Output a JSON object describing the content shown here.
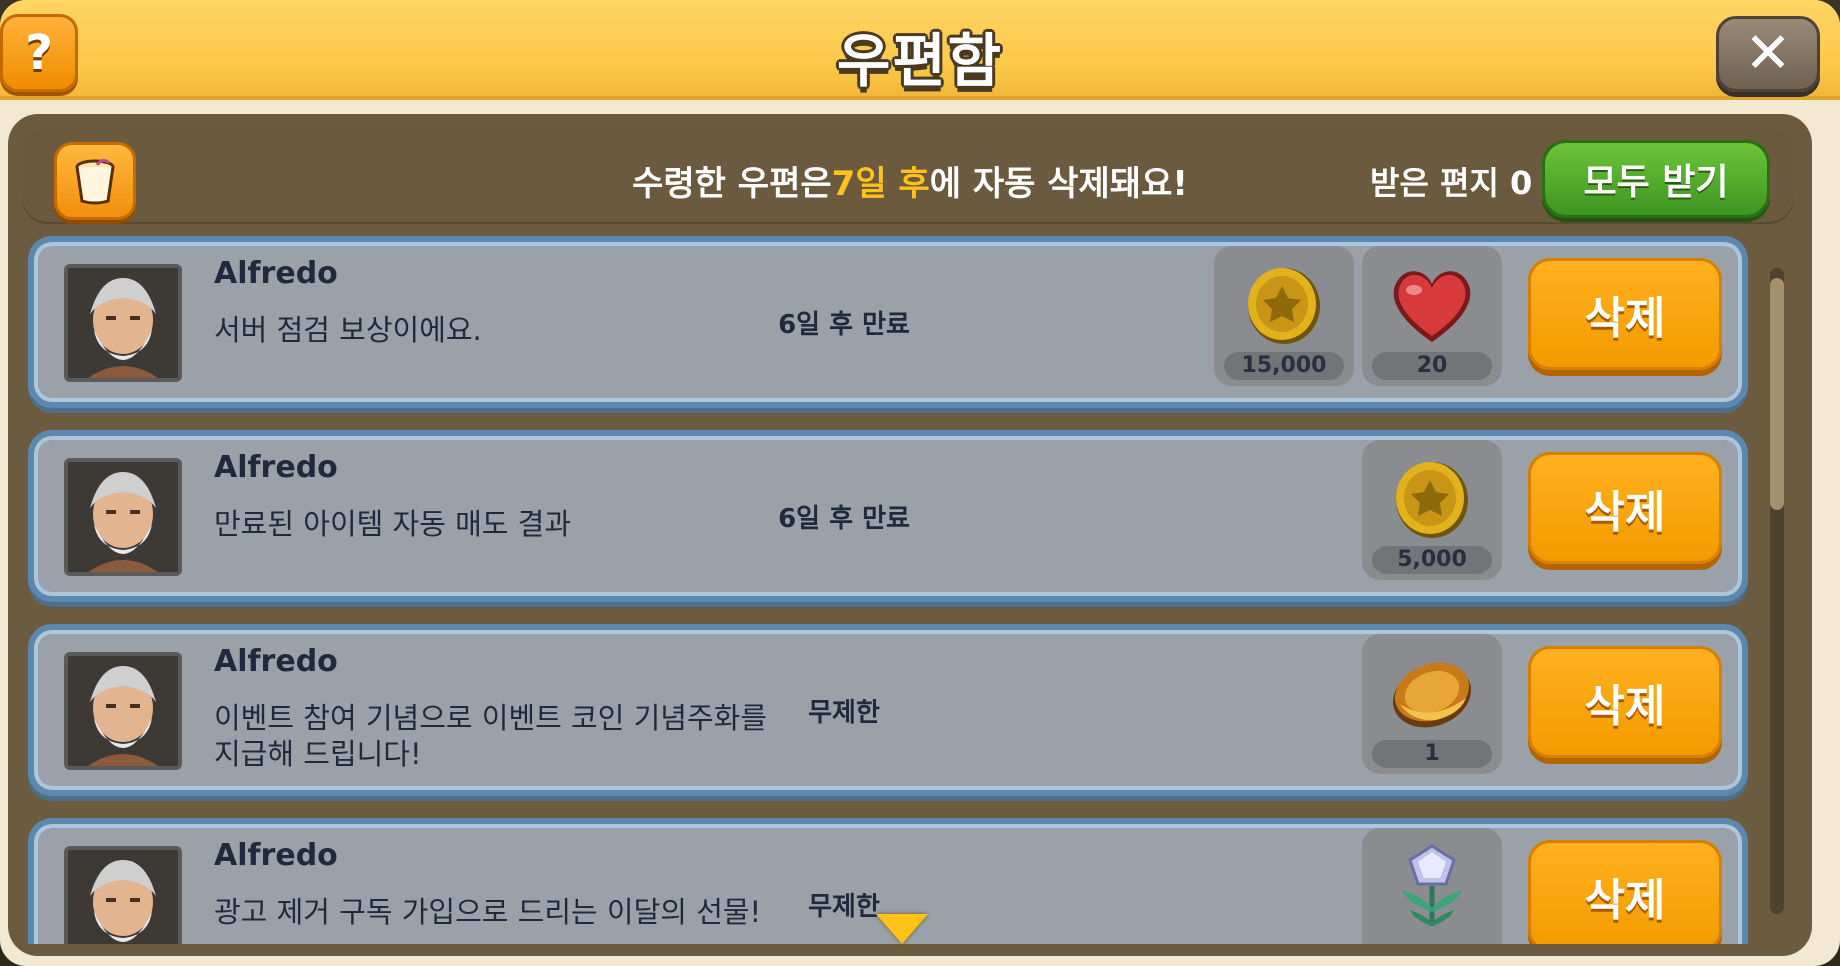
{
  "window": {
    "title": "우편함"
  },
  "header": {
    "help_label": "?",
    "close_label": "✕",
    "notice_before": "수령한 우편은",
    "notice_highlight": "7일 후",
    "notice_after": "에 자동 삭제돼요!",
    "received_label": "받은 편지 0",
    "receive_all_label": "모두 받기"
  },
  "mails": [
    {
      "sender": "Alfredo",
      "message": "서버 점검 보상이에요.",
      "expiry": "6일 후 만료",
      "rewards": [
        {
          "icon": "gold-coin-icon",
          "qty": "15,000"
        },
        {
          "icon": "heart-icon",
          "qty": "20"
        }
      ],
      "delete_label": "삭제"
    },
    {
      "sender": "Alfredo",
      "message": "만료된 아이템 자동 매도 결과",
      "expiry": "6일 후 만료",
      "rewards": [
        {
          "icon": "gold-coin-icon",
          "qty": "5,000"
        }
      ],
      "delete_label": "삭제"
    },
    {
      "sender": "Alfredo",
      "message": "이벤트 참여 기념으로 이벤트 코인 기념주화를 지급해 드립니다!",
      "expiry": "무제한",
      "rewards": [
        {
          "icon": "commemorative-coin-icon",
          "qty": "1"
        }
      ],
      "delete_label": "삭제"
    },
    {
      "sender": "Alfredo",
      "message": "광고 제거 구독 가입으로 드리는 이달의 선물!",
      "expiry": "무제한",
      "rewards": [
        {
          "icon": "crystal-flower-icon",
          "qty": ""
        }
      ],
      "delete_label": "삭제"
    }
  ]
}
